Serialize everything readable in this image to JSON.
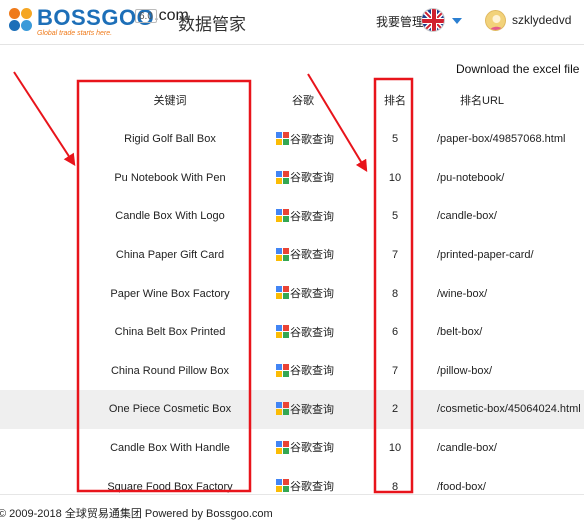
{
  "header": {
    "logo_text": "BOSSGOO",
    "logo_tagline": "Global trade starts here.",
    "logo_com": ".com",
    "version": "6.0",
    "app_title": "数据管家",
    "manage_label": "我要管理",
    "username": "szklydedvd"
  },
  "actions": {
    "download_label": "Download the excel file"
  },
  "table": {
    "headers": [
      "关键词",
      "谷歌",
      "排名",
      "排名URL"
    ],
    "google_label": "谷歌查询",
    "rows": [
      {
        "keyword": "Rigid Golf Ball Box",
        "rank": "5",
        "url": "/paper-box/49857068.html"
      },
      {
        "keyword": "Pu Notebook With Pen",
        "rank": "10",
        "url": "/pu-notebook/"
      },
      {
        "keyword": "Candle Box With Logo",
        "rank": "5",
        "url": "/candle-box/"
      },
      {
        "keyword": "China Paper Gift Card",
        "rank": "7",
        "url": "/printed-paper-card/"
      },
      {
        "keyword": "Paper Wine Box Factory",
        "rank": "8",
        "url": "/wine-box/"
      },
      {
        "keyword": "China Belt Box Printed",
        "rank": "6",
        "url": "/belt-box/"
      },
      {
        "keyword": "China Round Pillow Box",
        "rank": "7",
        "url": "/pillow-box/"
      },
      {
        "keyword": "One Piece Cosmetic Box",
        "rank": "2",
        "url": "/cosmetic-box/45064024.html"
      },
      {
        "keyword": "Candle Box With Handle",
        "rank": "10",
        "url": "/candle-box/"
      },
      {
        "keyword": "Square Food Box Factory",
        "rank": "8",
        "url": "/food-box/"
      }
    ],
    "highlighted_row": 7
  },
  "footer": {
    "copyright": "© 2009-2018 全球贸易通集团 Powered by Bossgoo.com"
  },
  "colors": {
    "annotation_red": "#e8141b",
    "accent_blue": "#2b7fd1",
    "logo_orange": "#ef7a1a",
    "logo_blue": "#1d6fb8"
  }
}
